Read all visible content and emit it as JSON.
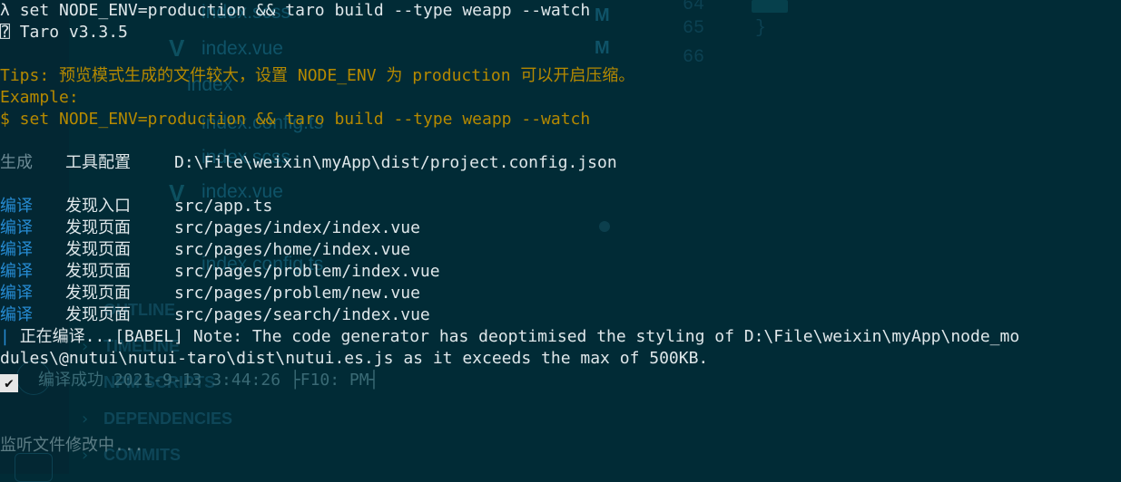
{
  "ghost": {
    "files": [
      "index.scss",
      "index.vue",
      "index",
      "index.config.ts",
      "index.scss",
      "index.vue",
      "index.config.ts"
    ],
    "badges": [
      "M",
      "M"
    ],
    "line_numbers": [
      "64",
      "65",
      "66"
    ],
    "code_brace": "}",
    "sections": [
      "OUTLINE",
      "TIMELINE",
      "NPM SCRIPTS",
      "DEPENDENCIES",
      "COMMITS"
    ]
  },
  "terminal": {
    "cmd1_prompt": "λ",
    "cmd1": "set NODE_ENV=production && taro build --type weapp --watch",
    "version": "Taro v3.3.5",
    "version_glyph": "⍰",
    "tips": "Tips: 预览模式生成的文件较大，设置 NODE_ENV 为 production 可以开启压缩。",
    "example_label": "Example:",
    "example_cmd": "$ set NODE_ENV=production && taro build --type weapp --watch",
    "gen_tag": "生成",
    "gen_label": "工具配置",
    "gen_path": "D:\\File\\weixin\\myApp\\dist/project.config.json",
    "compile_rows": [
      {
        "tag": "编译",
        "label": "发现入口",
        "path": "src/app.ts"
      },
      {
        "tag": "编译",
        "label": "发现页面",
        "path": "src/pages/index/index.vue"
      },
      {
        "tag": "编译",
        "label": "发现页面",
        "path": "src/pages/home/index.vue"
      },
      {
        "tag": "编译",
        "label": "发现页面",
        "path": "src/pages/problem/index.vue"
      },
      {
        "tag": "编译",
        "label": "发现页面",
        "path": "src/pages/problem/new.vue"
      },
      {
        "tag": "编译",
        "label": "发现页面",
        "path": "src/pages/search/index.vue"
      }
    ],
    "babel_spinner": "|",
    "babel_line1": "正在编译...[BABEL] Note: The code generator has deoptimised the styling of D:\\File\\weixin\\myApp\\node_mo",
    "babel_line2": "dules\\@nutui\\nutui-taro\\dist\\nutui.es.js as it exceeds the max of 500KB.",
    "check_glyph": "✔",
    "success": "编译成功 2021-9-13 3:44:26 ├F10: PM┤",
    "watching": "监听文件修改中..."
  }
}
